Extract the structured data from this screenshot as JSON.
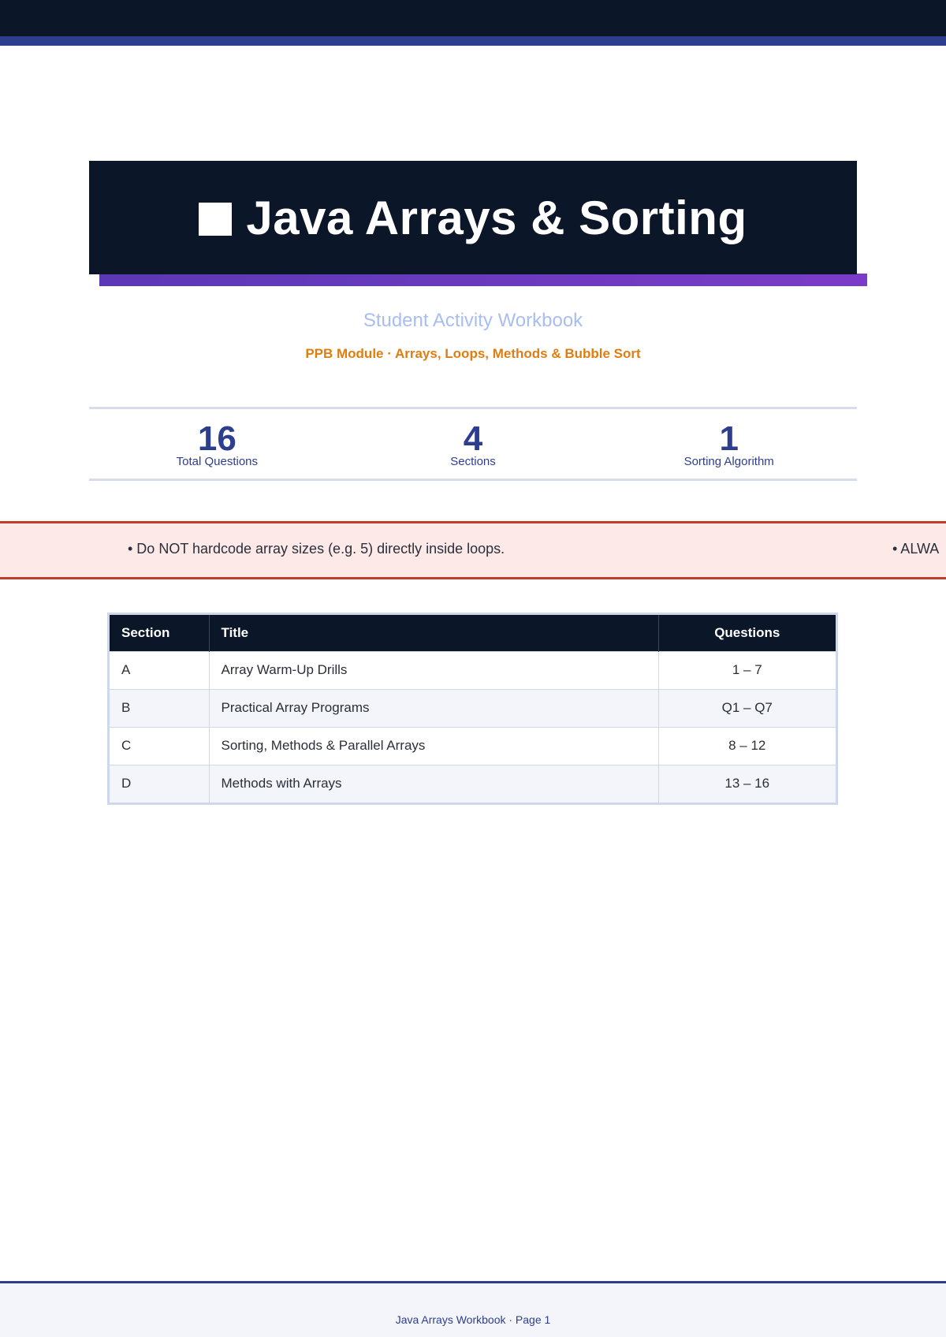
{
  "header": {
    "title_icon": "square-icon",
    "title": "Java Arrays & Sorting",
    "subtitle": "Student Activity Workbook",
    "module": "PPB Module · Arrays, Loops, Methods & Bubble Sort"
  },
  "stats": [
    {
      "value": "16",
      "label": "Total Questions"
    },
    {
      "value": "4",
      "label": "Sections"
    },
    {
      "value": "1",
      "label": "Sorting Algorithm"
    }
  ],
  "notice": {
    "items": [
      "• Do NOT hardcode array sizes (e.g. 5) directly inside loops.",
      "• ALWA"
    ]
  },
  "sections_table": {
    "headers": [
      "Section",
      "Title",
      "Questions"
    ],
    "rows": [
      [
        "A",
        "Array Warm-Up Drills",
        "1 – 7"
      ],
      [
        "B",
        "Practical Array Programs",
        "Q1 – Q7"
      ],
      [
        "C",
        "Sorting, Methods & Parallel Arrays",
        "8 – 12"
      ],
      [
        "D",
        "Methods with Arrays",
        "13 – 16"
      ]
    ]
  },
  "footer": {
    "text": "Java Arrays Workbook · Page 1"
  },
  "colors": {
    "navy": "#0c1629",
    "accent_blue": "#2d3e8e",
    "accent_purple": "#6a3ac0",
    "orange": "#e07d10",
    "notice_red": "#c43a2b"
  }
}
